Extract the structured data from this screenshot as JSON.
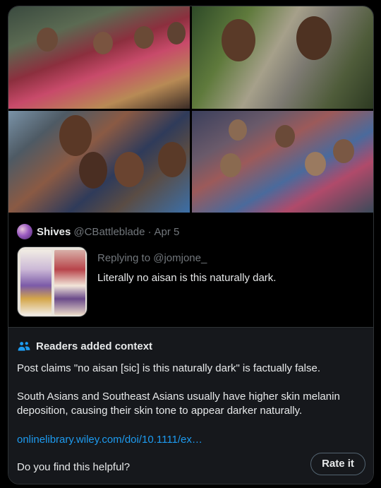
{
  "quoted_tweet": {
    "name": "Shives",
    "handle": "@CBattleblade",
    "dot": "·",
    "date": "Apr 5",
    "replying_prefix": "Replying to",
    "replying_handle": "@jomjone_",
    "text": "Literally no aisan is this naturally dark."
  },
  "community_note": {
    "title": "Readers added context",
    "icon": "readers-icon",
    "paragraph1": "Post claims \"no aisan [sic] is this naturally dark\"  is factually false.",
    "paragraph2": "South Asians and Southeast Asians usually have higher skin melanin deposition, causing their skin tone to appear darker naturally.",
    "link": "onlinelibrary.wiley.com/doi/10.1111/ex…",
    "question": "Do you find this helpful?",
    "rate_button": "Rate it"
  },
  "colors": {
    "background": "#000000",
    "note_background": "#16181c",
    "link": "#1d9bf0",
    "muted": "#71767b",
    "border": "#2f3336",
    "accent_icon": "#1d9bf0"
  }
}
